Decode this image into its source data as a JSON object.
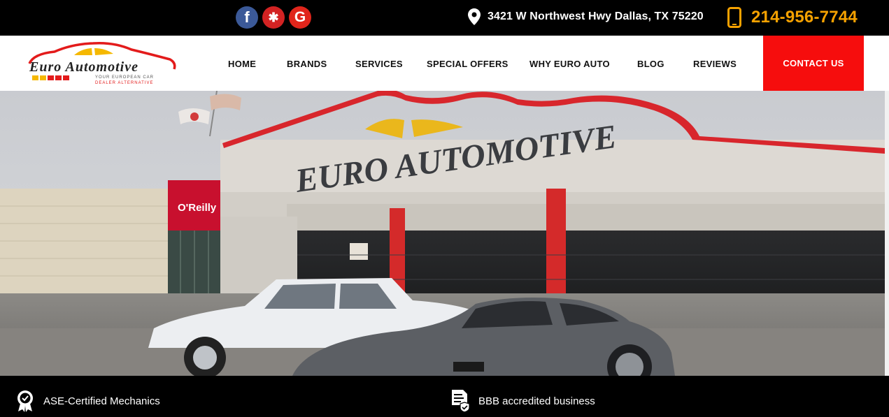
{
  "topbar": {
    "social": [
      {
        "name": "facebook-icon",
        "glyph": "f"
      },
      {
        "name": "yelp-icon",
        "glyph": "✱"
      },
      {
        "name": "google-icon",
        "glyph": "G"
      }
    ],
    "address": "3421 W Northwest Hwy Dallas, TX 75220",
    "phone": "214-956-7744"
  },
  "logo": {
    "name": "Euro Automotive",
    "tagline": "YOUR EUROPEAN CAR DEALER ALTERNATIVE"
  },
  "nav": {
    "items": [
      "HOME",
      "BRANDS",
      "SERVICES",
      "SPECIAL OFFERS",
      "WHY EURO AUTO",
      "BLOG",
      "REVIEWS"
    ],
    "contact": "CONTACT US"
  },
  "hero": {
    "sign": "EURO AUTOMOTIVE",
    "neighbor_sign": "O'Reilly"
  },
  "features": [
    {
      "icon": "certified-badge-icon",
      "label": "ASE-Certified Mechanics"
    },
    {
      "icon": "accredited-document-icon",
      "label": "BBB accredited business"
    }
  ],
  "colors": {
    "accent_red": "#f60d0d",
    "phone_orange": "#f5a100",
    "bar_black": "#000000"
  }
}
